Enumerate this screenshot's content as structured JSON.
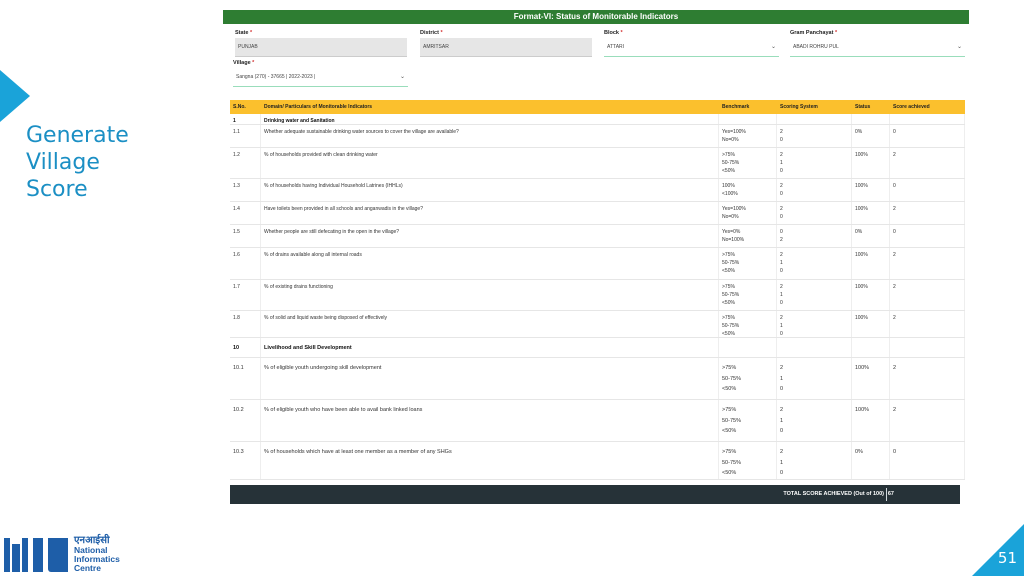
{
  "side": {
    "title_lines": [
      "Generate",
      "Village",
      "Score"
    ],
    "slide_number": "51"
  },
  "logo": {
    "hindi": "एनआईसी",
    "line1": "National",
    "line2": "Informatics",
    "line3": "Centre"
  },
  "form": {
    "title": "Format-VI: Status of Monitorable Indicators",
    "fields": {
      "state": {
        "label": "State",
        "value": "PUNJAB"
      },
      "district": {
        "label": "District",
        "value": "AMRITSAR"
      },
      "block": {
        "label": "Block",
        "value": "ATTARI"
      },
      "gp": {
        "label": "Gram Panchayat",
        "value": "ABADI ROHRU PUL"
      },
      "village": {
        "label": "Village",
        "value": "Sangna (270) - 37665 | 2022-2023 |"
      }
    }
  },
  "table": {
    "headers": [
      "S.No.",
      "Domain/ Particulars of Monitorable Indicators",
      "Benchmark",
      "Scoring System",
      "Status",
      "Score achieved"
    ],
    "rows": [
      {
        "sno": "1",
        "text": "Drinking water and Sanitation",
        "section": true,
        "bench": [],
        "scoring": [],
        "status": "",
        "score": ""
      },
      {
        "sno": "1.1",
        "text": "Whether adequate sustainable drinking water sources to cover the village are available?",
        "bench": [
          "Yes=100%",
          "No=0%"
        ],
        "scoring": [
          "2",
          "0"
        ],
        "status": "0%",
        "score": "0"
      },
      {
        "sno": "1.2",
        "text": "% of households provided with clean drinking water",
        "bench": [
          ">75%",
          "50-75%",
          "<50%"
        ],
        "scoring": [
          "2",
          "1",
          "0"
        ],
        "status": "100%",
        "score": "2"
      },
      {
        "sno": "1.3",
        "text": "% of households having Individual Household Latrines (IHHLs)",
        "bench": [
          "100%",
          "<100%"
        ],
        "scoring": [
          "2",
          "0"
        ],
        "status": "100%",
        "score": "0"
      },
      {
        "sno": "1.4",
        "text": "Have toilets been provided in all schools and anganwadis in the village?",
        "bench": [
          "Yes=100%",
          "No=0%"
        ],
        "scoring": [
          "2",
          "0"
        ],
        "status": "100%",
        "score": "2"
      },
      {
        "sno": "1.5",
        "text": "Whether people are still defecating in the open in the village?",
        "bench": [
          "Yes=0%",
          "No=100%"
        ],
        "scoring": [
          "0",
          "2"
        ],
        "status": "0%",
        "score": "0"
      },
      {
        "sno": "1.6",
        "text": "% of drains available along all internal roads",
        "bench": [
          ">75%",
          "50-75%",
          "<50%"
        ],
        "scoring": [
          "2",
          "1",
          "0"
        ],
        "status": "100%",
        "score": "2"
      },
      {
        "sno": "1.7",
        "text": "% of existing drains functioning",
        "bench": [
          ">75%",
          "50-75%",
          "<50%"
        ],
        "scoring": [
          "2",
          "1",
          "0"
        ],
        "status": "100%",
        "score": "2"
      },
      {
        "sno": "1.8",
        "text": "% of solid and liquid waste being disposed of effectively",
        "bench": [
          ">75%",
          "50-75%",
          "<50%"
        ],
        "scoring": [
          "2",
          "1",
          "0"
        ],
        "status": "100%",
        "score": "2"
      },
      {
        "sno": "10",
        "text": "Livelihood and Skill Development",
        "section": true,
        "big": true,
        "bench": [],
        "scoring": [],
        "status": "",
        "score": ""
      },
      {
        "sno": "10.1",
        "text": "% of eligible youth undergoing skill development",
        "big": true,
        "bench": [
          ">75%",
          "50-75%",
          "<50%"
        ],
        "scoring": [
          "2",
          "1",
          "0"
        ],
        "status": "100%",
        "score": "2"
      },
      {
        "sno": "10.2",
        "text": "% of eligible youth who have been able to avail bank linked loans",
        "big": true,
        "bench": [
          ">75%",
          "50-75%",
          "<50%"
        ],
        "scoring": [
          "2",
          "1",
          "0"
        ],
        "status": "100%",
        "score": "2"
      },
      {
        "sno": "10.3",
        "text": "% of households which have at least one member as a member of any SHGs",
        "big": true,
        "bench": [
          ">75%",
          "50-75%",
          "<50%"
        ],
        "scoring": [
          "2",
          "1",
          "0"
        ],
        "status": "0%",
        "score": "0"
      }
    ],
    "total_label": "TOTAL SCORE ACHIEVED (Out of 100)",
    "total_value": "67"
  }
}
